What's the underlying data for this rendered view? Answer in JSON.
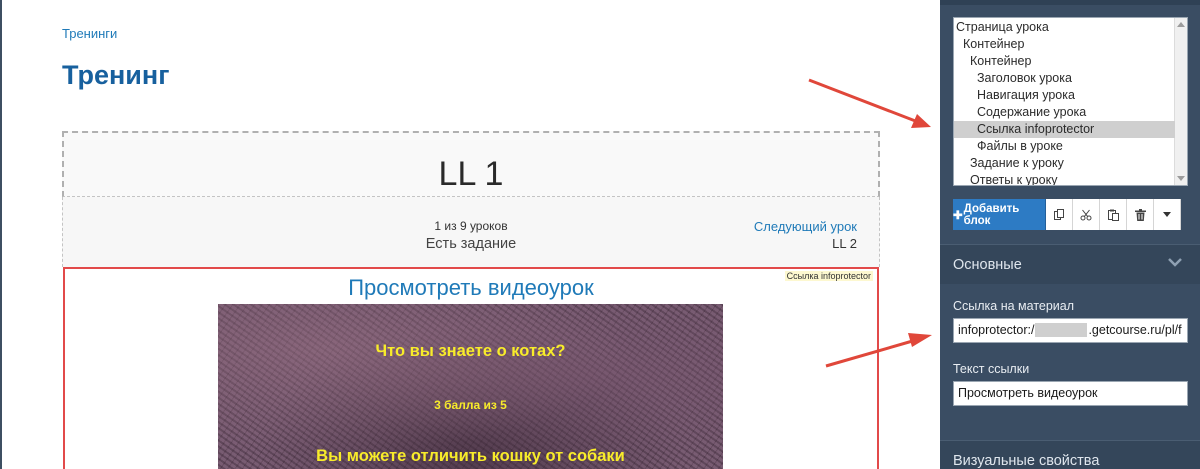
{
  "main": {
    "breadcrumb": "Тренинги",
    "page_title": "Тренинг",
    "lesson": {
      "title": "LL 1",
      "counter": "1 из 9 уроков",
      "task": "Есть задание",
      "next_label": "Следующий урок",
      "next_value": "LL 2",
      "content_badge": "Ссылка infoprotector",
      "video_link": "Просмотреть видеоурок",
      "video": {
        "title": "Что вы знаете о котах?",
        "score": "3 балла из 5",
        "subtitle": "Вы можете отличить кошку от собаки"
      }
    }
  },
  "panel": {
    "tree": [
      {
        "label": "Страница урока",
        "level": 0,
        "selected": false
      },
      {
        "label": "Контейнер",
        "level": 1,
        "selected": false
      },
      {
        "label": "Контейнер",
        "level": 2,
        "selected": false
      },
      {
        "label": "Заголовок урока",
        "level": 3,
        "selected": false
      },
      {
        "label": "Навигация урока",
        "level": 3,
        "selected": false
      },
      {
        "label": "Содержание урока",
        "level": 3,
        "selected": false
      },
      {
        "label": "Ссылка infoprotector",
        "level": 3,
        "selected": true
      },
      {
        "label": "Файлы в уроке",
        "level": 3,
        "selected": false
      },
      {
        "label": "Задание к уроку",
        "level": 2,
        "selected": false
      },
      {
        "label": "Ответы к уроку",
        "level": 2,
        "selected": false
      }
    ],
    "toolbar": {
      "add_block": "Добавить блок",
      "add_icon": "plus-icon",
      "tools": [
        "copy-icon",
        "cut-icon",
        "paste-icon",
        "trash-icon",
        "caret-down-icon"
      ]
    },
    "sections": {
      "basic": "Основные",
      "visual": "Визуальные свойства"
    },
    "link_field": {
      "label": "Ссылка на материал",
      "value_prefix": "infoprotector:/",
      "value_suffix": ".getcourse.ru/pl/f"
    },
    "text_field": {
      "label": "Текст ссылки",
      "value": "Просмотреть видеоурок"
    },
    "colors": {
      "panel_bg": "#3a4d63",
      "accent_blue": "#2d7bc4",
      "title_blue": "#17609e",
      "link_blue": "#1f7ab8",
      "highlight_red": "#e24a4a",
      "arrow_red": "#e0473a",
      "video_text": "#f8ec2a",
      "selected_row": "#cfcfcf"
    }
  }
}
